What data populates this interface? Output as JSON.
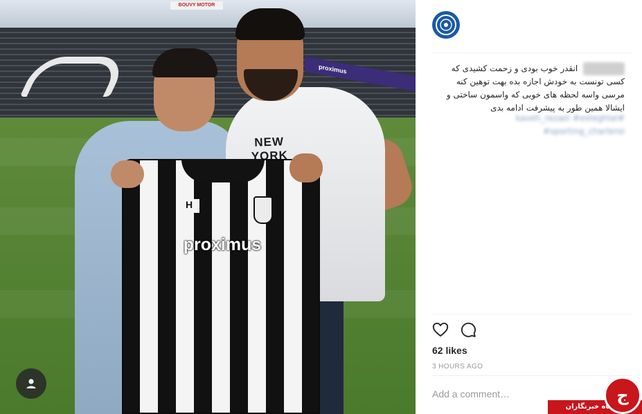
{
  "photo": {
    "stadium_sign": "BOUVY MOTOR",
    "ad_board_text": "proximus",
    "shirt_text": "NEW YORK",
    "jersey_sponsor": "proximus",
    "jersey_brand": "H"
  },
  "post": {
    "caption_username": "username",
    "caption": "انقدر خوب بودی و زحمت کشیدی که کسی تونست به خودش اجازه بده بهت توهین کنه مرسی واسه لحظه های خوبی که واسمون ساختی و ایشالا همین طور به پیشرفت ادامه بدی",
    "hashtags": "#kaveh_rezaei #esteghlal #sporting_charleroi",
    "likes": "62 likes",
    "time_ago": "3 HOURS AGO",
    "comment_placeholder": "Add a comment…",
    "icons": {
      "like": "heart-icon",
      "comment": "comment-bubble-icon",
      "tagged": "user-tag-icon"
    }
  },
  "watermark": {
    "text": "باشگاه خبرنگاران",
    "logo_letter": "ج"
  },
  "colors": {
    "accent_blue": "#1a5aa8",
    "watermark_red": "#c8161b",
    "muted_text": "#999999"
  }
}
